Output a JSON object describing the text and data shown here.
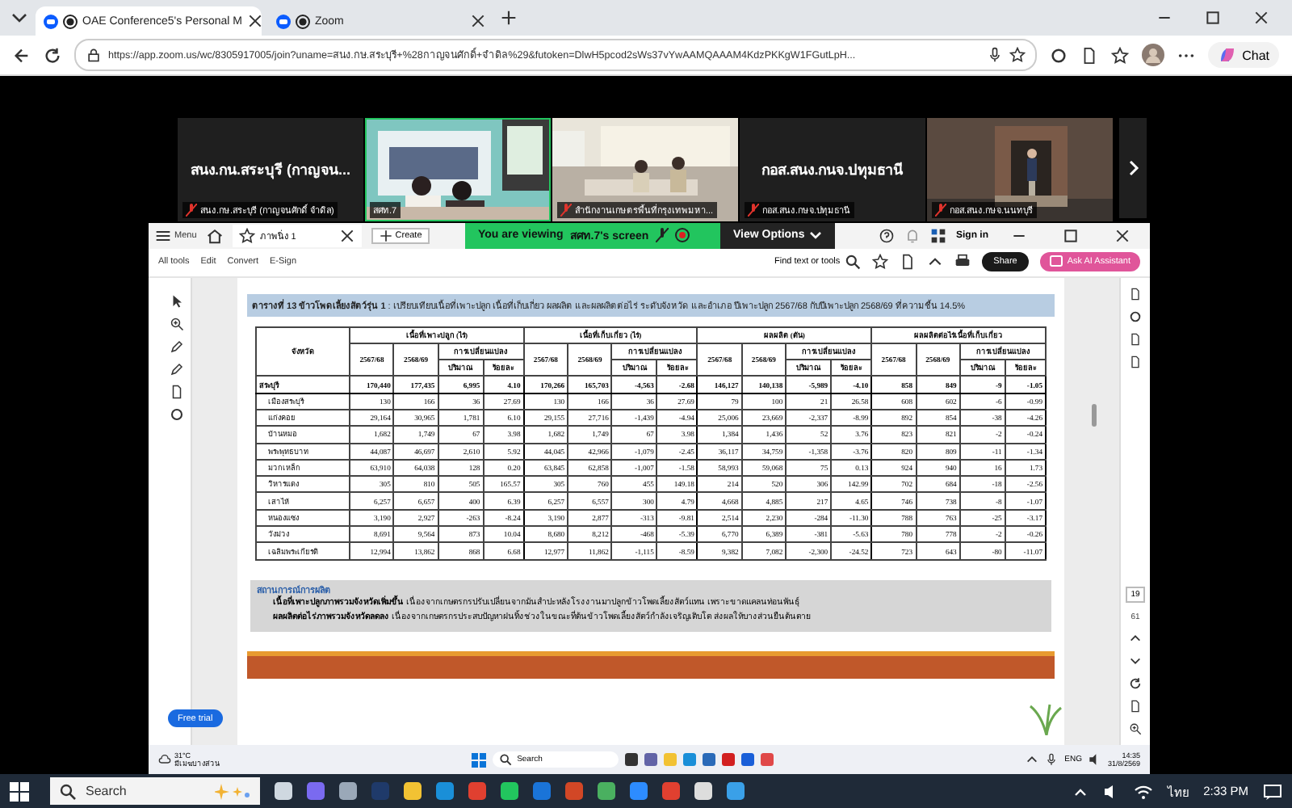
{
  "browser": {
    "tabs": [
      {
        "title": "OAE Conference5's Personal M",
        "selected": true
      },
      {
        "title": "Zoom",
        "selected": false
      }
    ],
    "url": "https://app.zoom.us/wc/8305917005/join?uname=สนง.กษ.สระบุรี+%28กาญจนศักดิ์+จำดิล%29&futoken=DlwH5pcod2sWs37vYwAAMQAAAM4KdzPKKgW1FGutLpH...",
    "chat": "Chat"
  },
  "meeting": {
    "participants": [
      {
        "kind": "name",
        "name": "สนง.กน.สระบุรี (กาญจน...",
        "label": "สนง.กษ.สระบุรี (กาญจนศักดิ์ จำดิล)",
        "muted": true,
        "speaking": false
      },
      {
        "kind": "video",
        "label": "สศท.7",
        "muted": false,
        "speaking": true
      },
      {
        "kind": "video",
        "label": "สำนักงานเกษตรพื้นที่กรุงเทพมหา...",
        "muted": true,
        "speaking": false
      },
      {
        "kind": "name",
        "name": "กอส.สนง.กนจ.ปทุมธานี",
        "label": "กอส.สนง.กษจ.ปทุมธานี",
        "muted": true,
        "speaking": false
      },
      {
        "kind": "video",
        "label": "กอส.สนง.กษจ.นนทบุรี",
        "muted": true,
        "speaking": false
      }
    ]
  },
  "share_banner": {
    "prefix": "You are viewing",
    "presenter": "สศท.7's screen",
    "options": "View Options"
  },
  "acrobat": {
    "menu": "Menu",
    "tab": "ภาพนิ่ง 1",
    "create": "Create",
    "sign_in": "Sign in",
    "tools": [
      "All tools",
      "Edit",
      "Convert",
      "E-Sign"
    ],
    "find": "Find text or tools",
    "share": "Share",
    "ai": "Ask AI Assistant",
    "free_trial": "Free trial",
    "page_current": "19",
    "page_total": "61"
  },
  "document": {
    "title": "**ตารางที่ 13 ข้าวโพดเลี้ยงสัตว์รุ่น 1** : เปรียบเทียบเนื้อที่เพาะปลูก เนื้อที่เก็บเกี่ยว ผลผลิต และผลผลิตต่อไร่ ระดับจังหวัด และอำเภอ ปีเพาะปลูก 2567/68 กับปีเพาะปลูก 2568/69 ที่ความชื้น 14.5%",
    "table": {
      "first_column": "จังหวัด",
      "groups": [
        {
          "title": "เนื้อที่เพาะปลูก (ไร่)",
          "years": [
            "2567/68",
            "2568/69"
          ],
          "change": "การเปลี่ยนแปลง",
          "change_columns": [
            "ปริมาณ",
            "ร้อยละ"
          ]
        },
        {
          "title": "เนื้อที่เก็บเกี่ยว (ไร่)",
          "years": [
            "2567/68",
            "2568/69"
          ],
          "change": "การเปลี่ยนแปลง",
          "change_columns": [
            "ปริมาณ",
            "ร้อยละ"
          ]
        },
        {
          "title": "ผลผลิต (ตัน)",
          "years": [
            "2567/68",
            "2568/69"
          ],
          "change": "การเปลี่ยนแปลง",
          "change_columns": [
            "ปริมาณ",
            "ร้อยละ"
          ]
        },
        {
          "title": "ผลผลิตต่อไร่เนื้อที่เก็บเกี่ยว",
          "years": [
            "2567/68",
            "2568/69"
          ],
          "change": "การเปลี่ยนแปลง",
          "change_columns": [
            "ปริมาณ",
            "ร้อยละ"
          ]
        }
      ],
      "rows": [
        {
          "kind": "total",
          "name": "สระบุรี",
          "values": [
            "170,440",
            "177,435",
            "6,995",
            "4.10",
            "170,266",
            "165,703",
            "-4,563",
            "-2.68",
            "146,127",
            "140,138",
            "-5,989",
            "-4.10",
            "858",
            "849",
            "-9",
            "-1.05"
          ]
        },
        {
          "kind": "district",
          "name": "เมืองสระบุรี",
          "values": [
            "130",
            "166",
            "36",
            "27.69",
            "130",
            "166",
            "36",
            "27.69",
            "79",
            "100",
            "21",
            "26.58",
            "608",
            "602",
            "-6",
            "-0.99"
          ]
        },
        {
          "kind": "district",
          "name": "แก่งคอย",
          "values": [
            "29,164",
            "30,965",
            "1,781",
            "6.10",
            "29,155",
            "27,716",
            "-1,439",
            "-4.94",
            "25,006",
            "23,669",
            "-2,337",
            "-8.99",
            "892",
            "854",
            "-38",
            "-4.26"
          ]
        },
        {
          "kind": "district",
          "name": "บ้านหมอ",
          "values": [
            "1,682",
            "1,749",
            "67",
            "3.98",
            "1,682",
            "1,749",
            "67",
            "3.98",
            "1,384",
            "1,436",
            "52",
            "3.76",
            "823",
            "821",
            "-2",
            "-0.24"
          ]
        },
        {
          "kind": "district",
          "name": "พระพุทธบาท",
          "values": [
            "44,087",
            "46,697",
            "2,610",
            "5.92",
            "44,045",
            "42,966",
            "-1,079",
            "-2.45",
            "36,117",
            "34,759",
            "-1,358",
            "-3.76",
            "820",
            "809",
            "-11",
            "-1.34"
          ]
        },
        {
          "kind": "district",
          "name": "มวกเหล็ก",
          "values": [
            "63,910",
            "64,038",
            "128",
            "0.20",
            "63,845",
            "62,858",
            "-1,007",
            "-1.58",
            "58,993",
            "59,068",
            "75",
            "0.13",
            "924",
            "940",
            "16",
            "1.73"
          ]
        },
        {
          "kind": "district",
          "name": "วิหารแดง",
          "values": [
            "305",
            "810",
            "505",
            "165.57",
            "305",
            "760",
            "455",
            "149.18",
            "214",
            "520",
            "306",
            "142.99",
            "702",
            "684",
            "-18",
            "-2.56"
          ]
        },
        {
          "kind": "district",
          "name": "เสาไห้",
          "values": [
            "6,257",
            "6,657",
            "400",
            "6.39",
            "6,257",
            "6,557",
            "300",
            "4.79",
            "4,668",
            "4,885",
            "217",
            "4.65",
            "746",
            "738",
            "-8",
            "-1.07"
          ]
        },
        {
          "kind": "district",
          "name": "หนองแซง",
          "values": [
            "3,190",
            "2,927",
            "-263",
            "-8.24",
            "3,190",
            "2,877",
            "-313",
            "-9.81",
            "2,514",
            "2,230",
            "-284",
            "-11.30",
            "788",
            "763",
            "-25",
            "-3.17"
          ]
        },
        {
          "kind": "district",
          "name": "วังม่วง",
          "values": [
            "8,691",
            "9,564",
            "873",
            "10.04",
            "8,680",
            "8,212",
            "-468",
            "-5.39",
            "6,770",
            "6,389",
            "-381",
            "-5.63",
            "780",
            "778",
            "-2",
            "-0.26"
          ]
        },
        {
          "kind": "district",
          "name": "เฉลิมพระเกียรติ",
          "values": [
            "12,994",
            "13,862",
            "868",
            "6.68",
            "12,977",
            "11,862",
            "-1,115",
            "-8.59",
            "9,382",
            "7,082",
            "-2,300",
            "-24.52",
            "723",
            "643",
            "-80",
            "-11.07"
          ]
        }
      ]
    },
    "note": {
      "heading": "สถานการณ์การผลิต",
      "lines": [
        "**เนื้อที่เพาะปลูกภาพรวมจังหวัดเพิ่มขึ้น** เนื่องจากเกษตรกรปรับเปลี่ยนจากมันสำปะหลังโรงงานมาปลูกข้าวโพดเลี้ยงสัตว์แทน เพราะขาดแคลนท่อนพันธุ์",
        "**ผลผลิตต่อไร่ภาพรวมจังหวัดลดลง** เนื่องจากเกษตรกรประสบปัญหาฝนทิ้งช่วงในขณะที่ต้นข้าวโพดเลี้ยงสัตว์กำลังเจริญเติบโต ส่งผลให้บางส่วนยืนต้นตาย"
      ]
    }
  },
  "inner_taskbar": {
    "temperature": "31°C",
    "weather": "มีเมฆบางส่วน",
    "search": "Search",
    "language": "ENG",
    "time": "14:35",
    "date": "31/8/2569"
  },
  "taskbar": {
    "search": "Search",
    "language": "ไทย",
    "time": "2:33 PM"
  }
}
